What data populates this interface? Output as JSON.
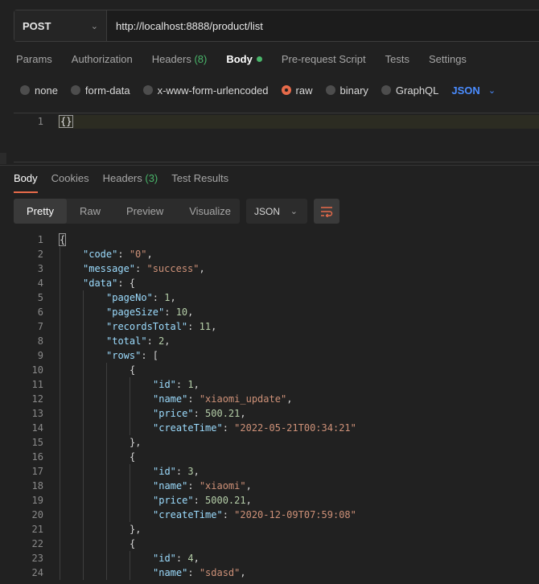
{
  "request": {
    "method": "POST",
    "url": "http://localhost:8888/product/list",
    "tabs": [
      {
        "label": "Params"
      },
      {
        "label": "Authorization"
      },
      {
        "label": "Headers",
        "count": "(8)"
      },
      {
        "label": "Body"
      },
      {
        "label": "Pre-request Script"
      },
      {
        "label": "Tests"
      },
      {
        "label": "Settings"
      }
    ],
    "body_types": [
      "none",
      "form-data",
      "x-www-form-urlencoded",
      "raw",
      "binary",
      "GraphQL"
    ],
    "body_language": "JSON",
    "editor": {
      "line_number": "1",
      "content": "{}"
    }
  },
  "response": {
    "tabs": [
      {
        "label": "Body"
      },
      {
        "label": "Cookies"
      },
      {
        "label": "Headers",
        "count": "(3)"
      },
      {
        "label": "Test Results"
      }
    ],
    "views": [
      "Pretty",
      "Raw",
      "Preview",
      "Visualize"
    ],
    "format": "JSON",
    "lines": [
      {
        "n": "1",
        "indent": 0,
        "parts": [
          [
            "p",
            "{"
          ]
        ]
      },
      {
        "n": "2",
        "indent": 1,
        "parts": [
          [
            "k",
            "\"code\""
          ],
          [
            "p",
            ": "
          ],
          [
            "s",
            "\"0\""
          ],
          [
            "p",
            ","
          ]
        ]
      },
      {
        "n": "3",
        "indent": 1,
        "parts": [
          [
            "k",
            "\"message\""
          ],
          [
            "p",
            ": "
          ],
          [
            "s",
            "\"success\""
          ],
          [
            "p",
            ","
          ]
        ]
      },
      {
        "n": "4",
        "indent": 1,
        "parts": [
          [
            "k",
            "\"data\""
          ],
          [
            "p",
            ": {"
          ]
        ]
      },
      {
        "n": "5",
        "indent": 2,
        "parts": [
          [
            "k",
            "\"pageNo\""
          ],
          [
            "p",
            ": "
          ],
          [
            "n",
            "1"
          ],
          [
            "p",
            ","
          ]
        ]
      },
      {
        "n": "6",
        "indent": 2,
        "parts": [
          [
            "k",
            "\"pageSize\""
          ],
          [
            "p",
            ": "
          ],
          [
            "n",
            "10"
          ],
          [
            "p",
            ","
          ]
        ]
      },
      {
        "n": "7",
        "indent": 2,
        "parts": [
          [
            "k",
            "\"recordsTotal\""
          ],
          [
            "p",
            ": "
          ],
          [
            "n",
            "11"
          ],
          [
            "p",
            ","
          ]
        ]
      },
      {
        "n": "8",
        "indent": 2,
        "parts": [
          [
            "k",
            "\"total\""
          ],
          [
            "p",
            ": "
          ],
          [
            "n",
            "2"
          ],
          [
            "p",
            ","
          ]
        ]
      },
      {
        "n": "9",
        "indent": 2,
        "parts": [
          [
            "k",
            "\"rows\""
          ],
          [
            "p",
            ": ["
          ]
        ]
      },
      {
        "n": "10",
        "indent": 3,
        "parts": [
          [
            "p",
            "{"
          ]
        ]
      },
      {
        "n": "11",
        "indent": 4,
        "parts": [
          [
            "k",
            "\"id\""
          ],
          [
            "p",
            ": "
          ],
          [
            "n",
            "1"
          ],
          [
            "p",
            ","
          ]
        ]
      },
      {
        "n": "12",
        "indent": 4,
        "parts": [
          [
            "k",
            "\"name\""
          ],
          [
            "p",
            ": "
          ],
          [
            "s",
            "\"xiaomi_update\""
          ],
          [
            "p",
            ","
          ]
        ]
      },
      {
        "n": "13",
        "indent": 4,
        "parts": [
          [
            "k",
            "\"price\""
          ],
          [
            "p",
            ": "
          ],
          [
            "n",
            "500.21"
          ],
          [
            "p",
            ","
          ]
        ]
      },
      {
        "n": "14",
        "indent": 4,
        "parts": [
          [
            "k",
            "\"createTime\""
          ],
          [
            "p",
            ": "
          ],
          [
            "s",
            "\"2022-05-21T00:34:21\""
          ]
        ]
      },
      {
        "n": "15",
        "indent": 3,
        "parts": [
          [
            "p",
            "},"
          ]
        ]
      },
      {
        "n": "16",
        "indent": 3,
        "parts": [
          [
            "p",
            "{"
          ]
        ]
      },
      {
        "n": "17",
        "indent": 4,
        "parts": [
          [
            "k",
            "\"id\""
          ],
          [
            "p",
            ": "
          ],
          [
            "n",
            "3"
          ],
          [
            "p",
            ","
          ]
        ]
      },
      {
        "n": "18",
        "indent": 4,
        "parts": [
          [
            "k",
            "\"name\""
          ],
          [
            "p",
            ": "
          ],
          [
            "s",
            "\"xiaomi\""
          ],
          [
            "p",
            ","
          ]
        ]
      },
      {
        "n": "19",
        "indent": 4,
        "parts": [
          [
            "k",
            "\"price\""
          ],
          [
            "p",
            ": "
          ],
          [
            "n",
            "5000.21"
          ],
          [
            "p",
            ","
          ]
        ]
      },
      {
        "n": "20",
        "indent": 4,
        "parts": [
          [
            "k",
            "\"createTime\""
          ],
          [
            "p",
            ": "
          ],
          [
            "s",
            "\"2020-12-09T07:59:08\""
          ]
        ]
      },
      {
        "n": "21",
        "indent": 3,
        "parts": [
          [
            "p",
            "},"
          ]
        ]
      },
      {
        "n": "22",
        "indent": 3,
        "parts": [
          [
            "p",
            "{"
          ]
        ]
      },
      {
        "n": "23",
        "indent": 4,
        "parts": [
          [
            "k",
            "\"id\""
          ],
          [
            "p",
            ": "
          ],
          [
            "n",
            "4"
          ],
          [
            "p",
            ","
          ]
        ]
      },
      {
        "n": "24",
        "indent": 4,
        "parts": [
          [
            "k",
            "\"name\""
          ],
          [
            "p",
            ": "
          ],
          [
            "s",
            "\"sdasd\""
          ],
          [
            "p",
            ","
          ]
        ]
      }
    ]
  }
}
